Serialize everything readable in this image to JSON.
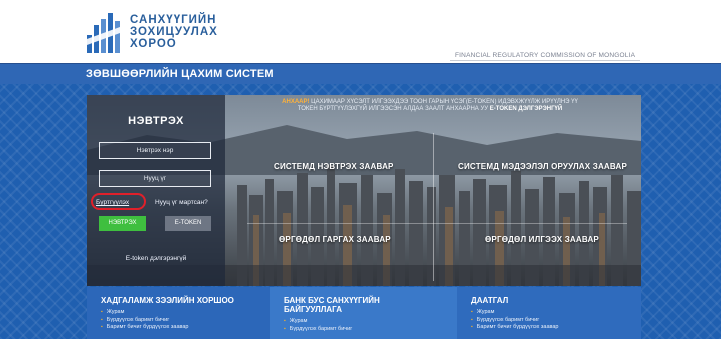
{
  "header": {
    "logo_lines": [
      "САНХҮҮГИЙН",
      "ЗОХИЦУУЛАХ",
      "ХОРОО"
    ],
    "subtitle": "FINANCIAL REGULATORY COMMISSION OF MONGOLIA",
    "brand_color": "#2a5f9c"
  },
  "titlebar": {
    "title": "ЗӨВШӨӨРЛИЙН ЦАХИМ СИСТЕМ",
    "color": "#2f67b5"
  },
  "notice": {
    "highlight": "АНХААР!",
    "text_line1": " ЦАХИМААР ХҮСЭЛТ ИЛГЭЭХДЭЭ ТООН ГАРЫН ҮСЭГ(Е-TOKEN) ИДЭВХЖҮҮЛЖ ИРҮҮЛНЭ ҮҮ",
    "text_line2": "ТОКЕН БҮРТГҮҮЛЭХГҮЙ ИЛГЭЭСЭН АЛДАА ЗААЛТ АНХААРНА УУ",
    "link": "E-TOKEN ДЭЛГЭРЭНГҮЙ"
  },
  "login": {
    "title": "НЭВТРЭХ",
    "username_placeholder": "Нэвтрэх нэр",
    "password_placeholder": "Нууц үг",
    "register_link": "Бүртгүүлэх",
    "forgot_link": "Нууц үг мартсан?",
    "login_button": "НЭВТРЭХ",
    "etoken_button": "E-TOKEN",
    "etoken_install_link": "E-token дэлгэрэнгүй",
    "accent_green": "#3fbf3f",
    "highlight_ring_color": "#e0202a"
  },
  "guides": {
    "system_login": "СИСТЕМД НЭВТРЭХ ЗААВАР",
    "enter_info": "СИСТЕМД МЭДЭЭЛЭЛ ОРУУЛАХ ЗААВАР",
    "create_request": "ӨРГӨДӨЛ ГАРГАХ ЗААВАР",
    "send_request": "ӨРГӨДӨЛ ИЛГЭЭХ ЗААВАР"
  },
  "columns": [
    {
      "title": "ХАДГАЛАМЖ ЗЭЭЛИЙН ХОРШОО",
      "items": [
        "Журам",
        "Бүрдүүлэх баримт бичиг",
        "Баримт бичиг бүрдүүлэх заавар"
      ]
    },
    {
      "title": "БАНК БУС САНХҮҮГИЙН БАЙГУУЛЛАГА",
      "items": [
        "Журам",
        "Бүрдүүлэх баримт бичиг"
      ]
    },
    {
      "title": "ДААТГАЛ",
      "items": [
        "Журам",
        "Бүрдүүлэх баримт бичиг",
        "Баримт бичиг бүрдүүлэх заавар"
      ]
    }
  ]
}
